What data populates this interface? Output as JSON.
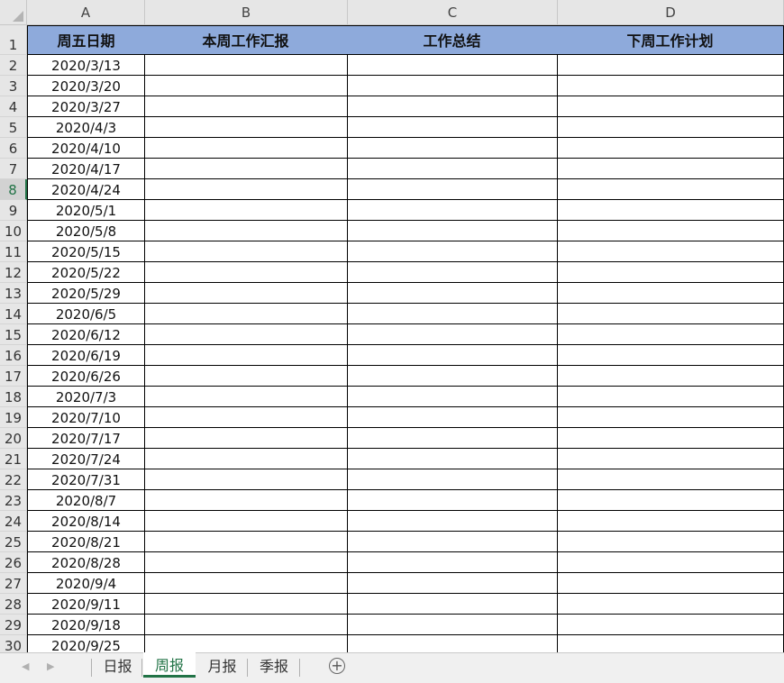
{
  "columns": [
    "A",
    "B",
    "C",
    "D"
  ],
  "header_fill": "#8eaadb",
  "accent": "#217346",
  "selected_row": 8,
  "table": {
    "headers": [
      "周五日期",
      "本周工作汇报",
      "工作总结",
      "下周工作计划"
    ],
    "dates": [
      "2020/3/13",
      "2020/3/20",
      "2020/3/27",
      "2020/4/3",
      "2020/4/10",
      "2020/4/17",
      "2020/4/24",
      "2020/5/1",
      "2020/5/8",
      "2020/5/15",
      "2020/5/22",
      "2020/5/29",
      "2020/6/5",
      "2020/6/12",
      "2020/6/19",
      "2020/6/26",
      "2020/7/3",
      "2020/7/10",
      "2020/7/17",
      "2020/7/24",
      "2020/7/31",
      "2020/8/7",
      "2020/8/14",
      "2020/8/21",
      "2020/8/28",
      "2020/9/4",
      "2020/9/11",
      "2020/9/18",
      "2020/9/25"
    ]
  },
  "row_numbers": [
    "1",
    "2",
    "3",
    "4",
    "5",
    "6",
    "7",
    "8",
    "9",
    "10",
    "11",
    "12",
    "13",
    "14",
    "15",
    "16",
    "17",
    "18",
    "19",
    "20",
    "21",
    "22",
    "23",
    "24",
    "25",
    "26",
    "27",
    "28",
    "29",
    "30"
  ],
  "tabs": [
    {
      "label": "日报",
      "active": false
    },
    {
      "label": "周报",
      "active": true
    },
    {
      "label": "月报",
      "active": false
    },
    {
      "label": "季报",
      "active": false
    }
  ],
  "icons": {
    "prev": "chevron-left-icon",
    "next": "chevron-right-icon",
    "add": "add-sheet-icon",
    "corner": "select-all-icon"
  },
  "add_symbol": "+"
}
